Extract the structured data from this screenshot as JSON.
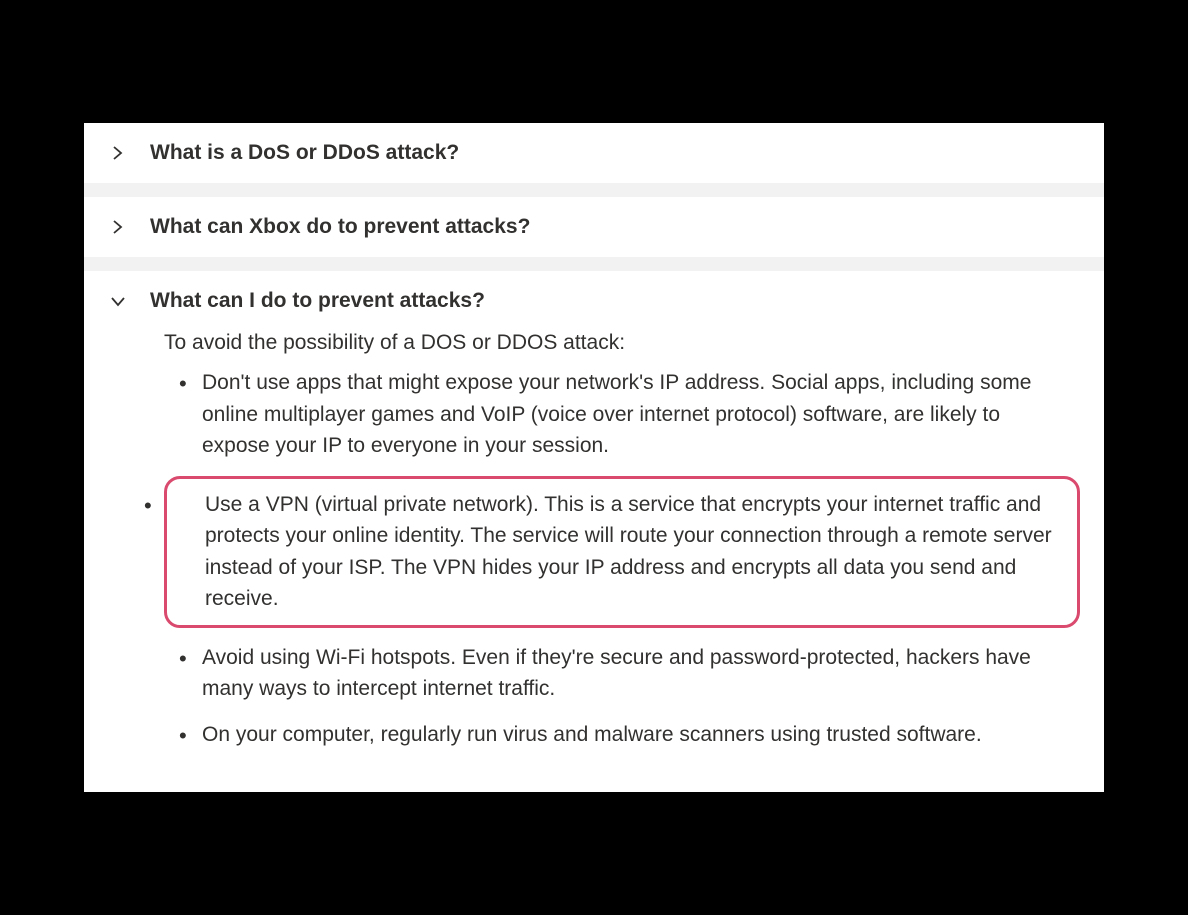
{
  "accordion": {
    "items": [
      {
        "title": "What is a DoS or DDoS attack?",
        "expanded": false
      },
      {
        "title": "What can Xbox do to prevent attacks?",
        "expanded": false
      },
      {
        "title": "What can I do to prevent attacks?",
        "expanded": true,
        "intro": "To avoid the possibility of a DOS or DDOS attack:",
        "bullets": [
          "Don't use apps that might expose your network's IP address. Social apps, including some online multiplayer games and VoIP (voice over internet protocol) software, are likely to expose your IP to everyone in your session.",
          "Use a VPN (virtual private network). This is a service that encrypts your internet traffic and protects your online identity. The service will route your connection through a remote server instead of your ISP. The VPN hides your IP address and encrypts all data you send and receive.",
          "Avoid using Wi-Fi hotspots. Even if they're secure and password-protected, hackers have many ways to intercept internet traffic.",
          "On your computer, regularly run virus and malware scanners using trusted software."
        ],
        "highlighted_index": 1
      }
    ]
  },
  "highlight_color": "#d94a6e"
}
